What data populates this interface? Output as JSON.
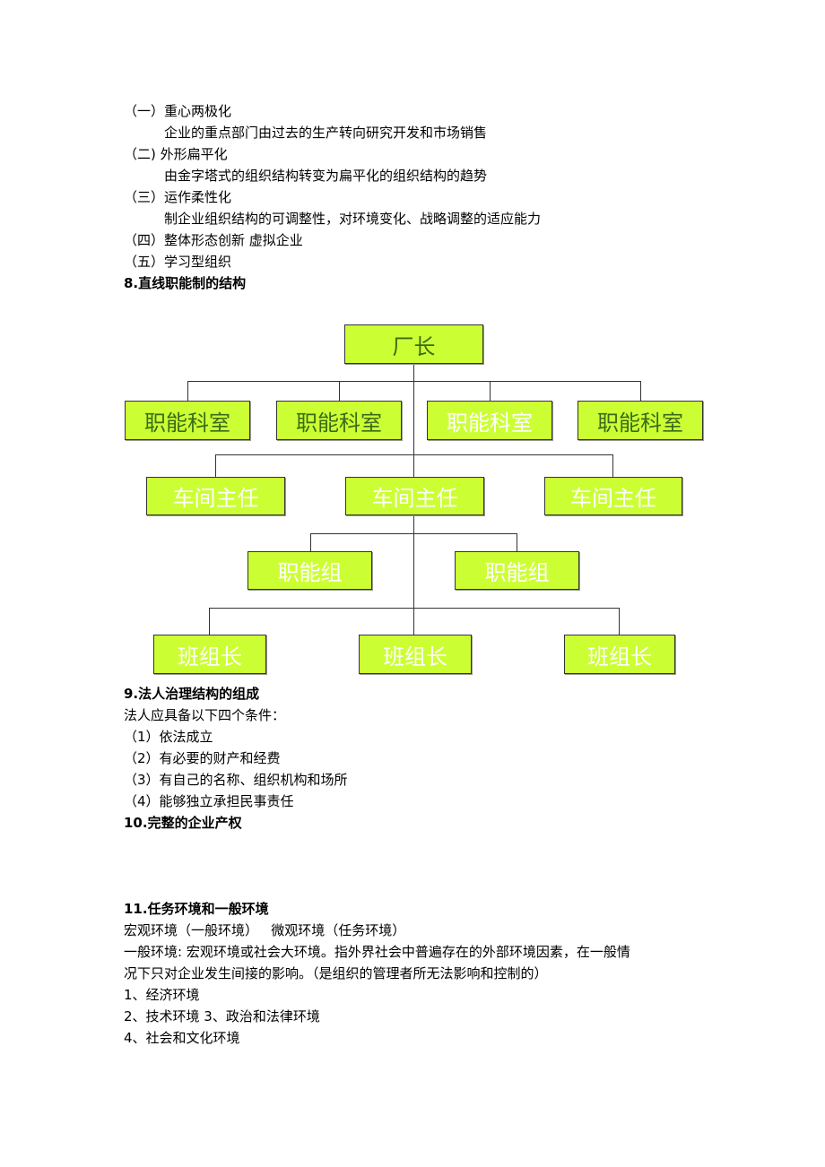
{
  "section7": {
    "items": [
      {
        "heading": "（一）重心两极化",
        "detail": "企业的重点部门由过去的生产转向研究开发和市场销售"
      },
      {
        "heading": "（二) 外形扁平化",
        "detail": "由金字塔式的组织结构转变为扁平化的组织结构的趋势"
      },
      {
        "heading": "（三）运作柔性化",
        "detail": "制企业组织结构的可调整性，对环境变化、战略调整的适应能力"
      },
      {
        "heading": "（四）整体形态创新 虚拟企业"
      },
      {
        "heading": "（五）学习型组织"
      }
    ]
  },
  "section8": {
    "title": "8.直线职能制的结构",
    "org_chart": {
      "root": "厂长",
      "level1": [
        "职能科室",
        "职能科室",
        "职能科室",
        "职能科室"
      ],
      "level2": [
        "车间主任",
        "车间主任",
        "车间主任"
      ],
      "level3": [
        "职能组",
        "职能组"
      ],
      "level4": [
        "班组长",
        "班组长",
        "班组长"
      ],
      "colors": {
        "box_fill": "#ccff33",
        "text_dark": "#3a6b1a",
        "text_light": "#ffffff",
        "line": "#333333"
      }
    }
  },
  "section9": {
    "title": "9.法人治理结构的组成",
    "intro": "法人应具备以下四个条件：",
    "conditions": [
      "（1）依法成立",
      "（2）有必要的财产和经费",
      "（3）有自己的名称、组织机构和场所",
      "（4）能够独立承担民事责任"
    ]
  },
  "section10": {
    "title": "10.完整的企业产权"
  },
  "section11": {
    "title": "11.任务环境和一般环境",
    "line1": "宏观环境（一般环境）   微观环境（任务环境）",
    "line2": "一般环境: 宏观环境或社会大环境。指外界社会中普遍存在的外部环境因素，在一般情",
    "line3": "况下只对企业发生间接的影响。（是组织的管理者所无法影响和控制的）",
    "items": [
      "1、经济环境",
      "2、技术环境 3、政治和法律环境",
      "4、社会和文化环境"
    ]
  }
}
